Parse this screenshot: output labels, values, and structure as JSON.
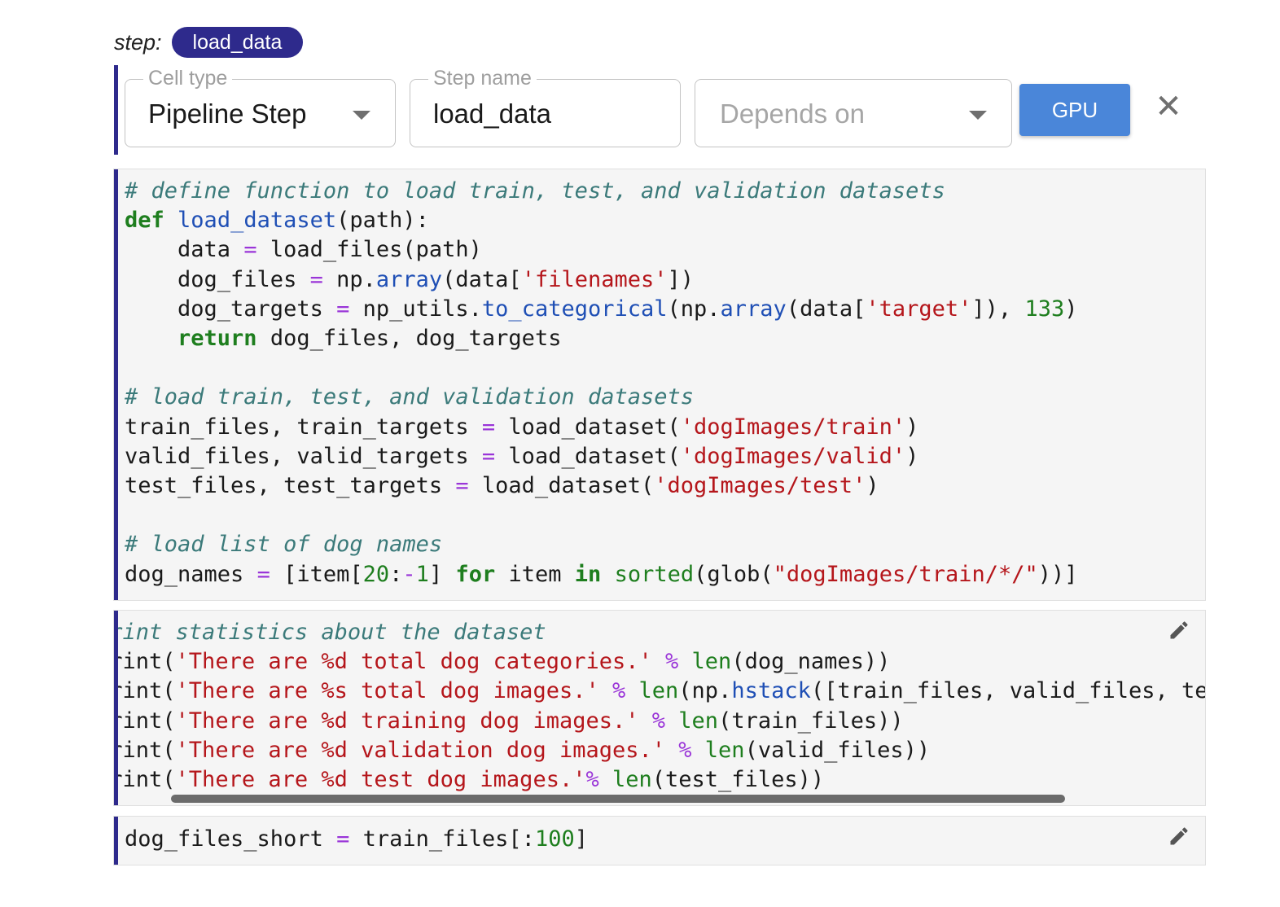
{
  "step": {
    "label": "step:",
    "name": "load_data"
  },
  "form": {
    "cell_type": {
      "legend": "Cell type",
      "value": "Pipeline Step"
    },
    "step_name": {
      "legend": "Step name",
      "value": "load_data"
    },
    "depends_on": {
      "placeholder": "Depends on"
    },
    "gpu_label": "GPU",
    "close_glyph": "✕"
  },
  "cells": [
    {
      "id": "cell-load",
      "editable": false
    },
    {
      "id": "cell-stats",
      "editable": true,
      "horizontal_scroll": true
    },
    {
      "id": "cell-short",
      "editable": true
    }
  ],
  "icons": {
    "pencil": "pencil-icon",
    "close": "close-icon",
    "caret": "chevron-down-icon"
  },
  "colors": {
    "accent": "#2e2a8c",
    "gpu": "#4a86d9"
  }
}
